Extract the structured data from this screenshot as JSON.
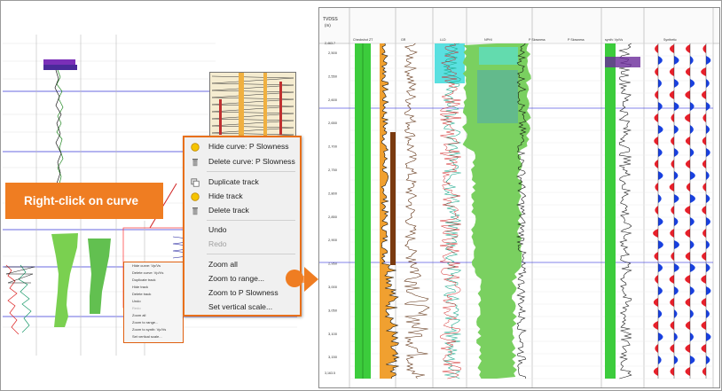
{
  "callout": {
    "text": "Right-click on curve"
  },
  "context_menu": {
    "items": [
      {
        "label": "Hide curve: P Slowness",
        "icon": "yellow-circle-icon",
        "disabled": false
      },
      {
        "label": "Delete curve: P Slowness",
        "icon": "trash-icon",
        "disabled": false
      },
      {
        "label": "Duplicate track",
        "icon": "duplicate-icon",
        "disabled": false
      },
      {
        "label": "Hide track",
        "icon": "yellow-circle-icon",
        "disabled": false
      },
      {
        "label": "Delete track",
        "icon": "trash-icon",
        "disabled": false
      },
      {
        "label": "Undo",
        "icon": "",
        "disabled": false
      },
      {
        "label": "Redo",
        "icon": "",
        "disabled": true
      },
      {
        "label": "Zoom all",
        "icon": "",
        "disabled": false
      },
      {
        "label": "Zoom to range...",
        "icon": "",
        "disabled": false
      },
      {
        "label": "Zoom to P Slowness",
        "icon": "",
        "disabled": false
      },
      {
        "label": "Set vertical scale...",
        "icon": "",
        "disabled": false
      }
    ]
  },
  "small_context_menu": {
    "items": [
      "Hide curve: Vp/Vs",
      "Delete curve: Vp/Vs",
      "Duplicate track",
      "Hide track",
      "Delete track",
      "Undo",
      "Redo",
      "Zoom all",
      "Zoom to range...",
      "Zoom to synth: Vp/Vs",
      "Set vertical scale..."
    ]
  },
  "log_view": {
    "index_header": "TVDSS",
    "index_unit": "(m)",
    "track_headers": [
      "Checkshot ZT",
      "GR",
      "LLD",
      "NPHI",
      "P Slowness",
      "P Slowness",
      "synth: Vp/Vs",
      "Synthetic"
    ],
    "depth_labels": [
      "2,500",
      "2,550",
      "2,600",
      "2,650",
      "2,700",
      "2,750",
      "2,800",
      "2,850",
      "2,900",
      "2,950",
      "3,000",
      "3,050",
      "3,100",
      "3,150"
    ],
    "top_depth": "2,463.7",
    "bottom_depth": "3,163.5"
  },
  "colors": {
    "accent_orange": "#ef7d22",
    "gr_fill": "#f0a030",
    "green_track": "#3ccc3c",
    "synthetic_red": "#e8202a",
    "synthetic_blue": "#1840e0"
  }
}
